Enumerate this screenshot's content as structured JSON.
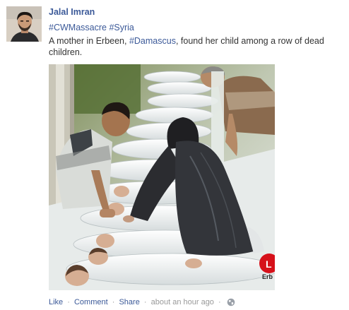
{
  "post": {
    "author": "Jalal Imran",
    "hashtags": [
      "#CWMassacre",
      "#Syria"
    ],
    "message_prefix": "A mother in Erbeen, ",
    "message_link": "#Damascus",
    "message_suffix": ", found her child among a row of dead children.",
    "photo_watermark": "Erb",
    "photo_logo_letter": "L"
  },
  "actions": {
    "like": "Like",
    "comment": "Comment",
    "share": "Share",
    "separator": "·",
    "timestamp": "about an hour ago",
    "audience_icon": "globe-icon"
  },
  "colors": {
    "link": "#3b5998",
    "text": "#333333",
    "meta": "#999999"
  }
}
